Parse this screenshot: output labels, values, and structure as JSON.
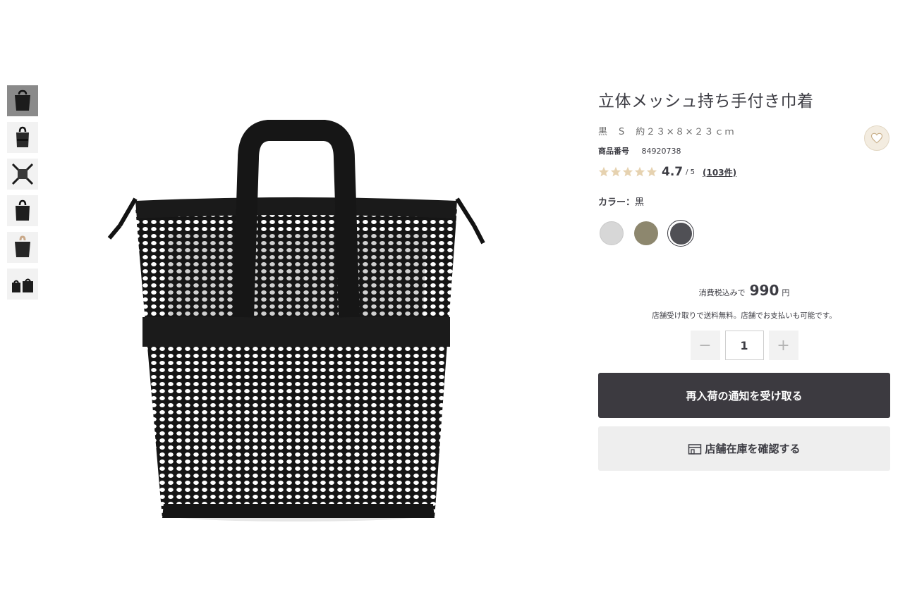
{
  "product": {
    "title": "立体メッシュ持ち手付き巾着",
    "subtitle": "黒　S　約２３×８×２３ｃｍ",
    "code_label": "商品番号",
    "code": "84920738",
    "rating": {
      "stars": 5,
      "score": "4.7",
      "out_of": "/ 5",
      "count": "(103件)"
    },
    "color_label": "カラー：",
    "color_value": "黒",
    "colors": [
      {
        "name": "light-gray",
        "hex": "#d7d7d7"
      },
      {
        "name": "khaki",
        "hex": "#8d876e"
      },
      {
        "name": "black",
        "hex": "#505055"
      }
    ],
    "selected_color_index": 2
  },
  "price": {
    "tax_label": "消費税込みで",
    "amount": "990",
    "currency": "円",
    "note": "店舗受け取りで送料無料。店舗でお支払いも可能です。"
  },
  "quantity": {
    "minus": "−",
    "value": "1",
    "plus": "+"
  },
  "buttons": {
    "restock": "再入荷の通知を受け取る",
    "store_stock": "店舗在庫を確認する"
  },
  "thumbnails": [
    "front",
    "back",
    "flat",
    "packed",
    "hand-held",
    "lineup"
  ],
  "icons": {
    "favorite": "heart-icon",
    "store": "store-icon",
    "star": "star-icon"
  },
  "colors": {
    "star": "#e6d2b0",
    "primary_button": "#3c3a40",
    "secondary_button": "#eeeeee",
    "favorite_bg": "#f3ece0"
  }
}
